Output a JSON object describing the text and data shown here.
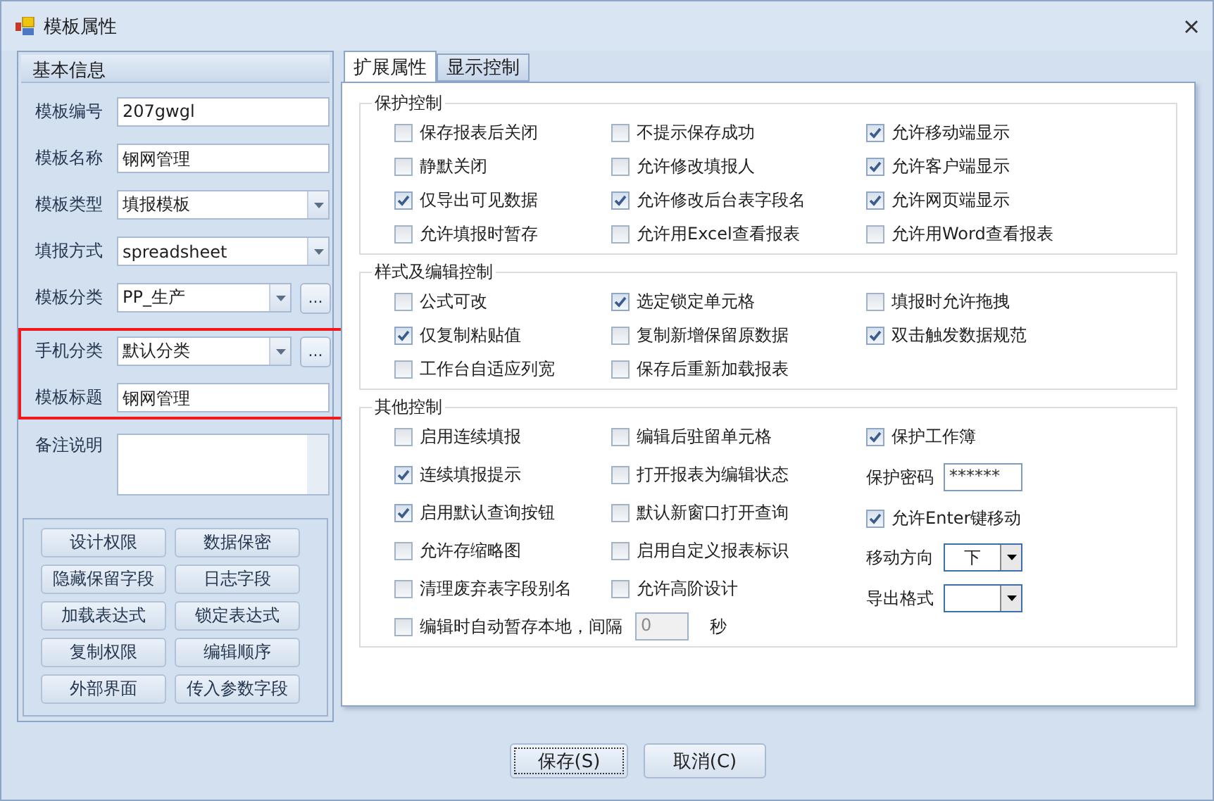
{
  "window": {
    "title": "模板属性"
  },
  "basic_info": {
    "title": "基本信息",
    "fields": [
      {
        "label": "模板编号",
        "kind": "text",
        "value": "207gwgl"
      },
      {
        "label": "模板名称",
        "kind": "text",
        "value": "钢网管理"
      },
      {
        "label": "模板类型",
        "kind": "combo",
        "value": "填报模板"
      },
      {
        "label": "填报方式",
        "kind": "combo",
        "value": "spreadsheet"
      },
      {
        "label": "模板分类",
        "kind": "combo_more",
        "value": "PP_生产",
        "more": "..."
      }
    ],
    "highlighted_fields": [
      {
        "label": "手机分类",
        "kind": "combo_more",
        "value": "默认分类",
        "more": "..."
      },
      {
        "label": "模板标题",
        "kind": "text",
        "value": "钢网管理"
      }
    ],
    "remarks": {
      "label": "备注说明"
    },
    "buttons": [
      "设计权限",
      "数据保密",
      "隐藏保留字段",
      "日志字段",
      "加载表达式",
      "锁定表达式",
      "复制权限",
      "编辑顺序",
      "外部界面",
      "传入参数字段"
    ]
  },
  "tabs": [
    {
      "label": "扩展属性",
      "selected": true
    },
    {
      "label": "显示控制",
      "selected": false
    }
  ],
  "sections": [
    {
      "title": "保护控制",
      "columns": [
        [
          {
            "kind": "checkbox",
            "label": "保存报表后关闭",
            "checked": false
          },
          {
            "kind": "checkbox",
            "label": "静默关闭",
            "checked": false
          },
          {
            "kind": "checkbox",
            "label": "仅导出可见数据",
            "checked": true
          },
          {
            "kind": "checkbox",
            "label": "允许填报时暂存",
            "checked": false
          }
        ],
        [
          {
            "kind": "checkbox",
            "label": "不提示保存成功",
            "checked": false
          },
          {
            "kind": "checkbox",
            "label": "允许修改填报人",
            "checked": false
          },
          {
            "kind": "checkbox",
            "label": "允许修改后台表字段名",
            "checked": true
          },
          {
            "kind": "checkbox",
            "label": "允许用Excel查看报表",
            "checked": false
          }
        ],
        [
          {
            "kind": "checkbox",
            "label": "允许移动端显示",
            "checked": true
          },
          {
            "kind": "checkbox",
            "label": "允许客户端显示",
            "checked": true
          },
          {
            "kind": "checkbox",
            "label": "允许网页端显示",
            "checked": true
          },
          {
            "kind": "checkbox",
            "label": "允许用Word查看报表",
            "checked": false
          }
        ]
      ]
    },
    {
      "title": "样式及编辑控制",
      "columns": [
        [
          {
            "kind": "checkbox",
            "label": "公式可改",
            "checked": false
          },
          {
            "kind": "checkbox",
            "label": "仅复制粘贴值",
            "checked": true
          },
          {
            "kind": "checkbox",
            "label": "工作台自适应列宽",
            "checked": false
          }
        ],
        [
          {
            "kind": "checkbox",
            "label": "选定锁定单元格",
            "checked": true
          },
          {
            "kind": "checkbox",
            "label": "复制新增保留原数据",
            "checked": false
          },
          {
            "kind": "checkbox",
            "label": "保存后重新加载报表",
            "checked": false
          }
        ],
        [
          {
            "kind": "checkbox",
            "label": "填报时允许拖拽",
            "checked": false
          },
          {
            "kind": "checkbox",
            "label": "双击触发数据规范",
            "checked": true
          }
        ]
      ]
    },
    {
      "title": "其他控制",
      "columns": [
        [
          {
            "kind": "checkbox",
            "label": "启用连续填报",
            "checked": false
          },
          {
            "kind": "checkbox",
            "label": "连续填报提示",
            "checked": true
          },
          {
            "kind": "checkbox",
            "label": "启用默认查询按钮",
            "checked": true
          },
          {
            "kind": "checkbox",
            "label": "允许存缩略图",
            "checked": false
          },
          {
            "kind": "checkbox",
            "label": "清理废弃表字段别名",
            "checked": false
          },
          {
            "kind": "interval",
            "label": "编辑时自动暂存本地，间隔",
            "checked": false,
            "value": "0",
            "unit": "秒",
            "disabled": true
          }
        ],
        [
          {
            "kind": "checkbox",
            "label": "编辑后驻留单元格",
            "checked": false
          },
          {
            "kind": "checkbox",
            "label": "打开报表为编辑状态",
            "checked": false
          },
          {
            "kind": "checkbox",
            "label": "默认新窗口打开查询",
            "checked": false
          },
          {
            "kind": "checkbox",
            "label": "启用自定义报表标识",
            "checked": false
          },
          {
            "kind": "checkbox",
            "label": "允许高阶设计",
            "checked": false
          }
        ],
        [
          {
            "kind": "checkbox",
            "label": "保护工作簿",
            "checked": true
          },
          {
            "kind": "password",
            "label": "保护密码",
            "value": "******"
          },
          {
            "kind": "checkbox",
            "label": "允许Enter键移动",
            "checked": true
          },
          {
            "kind": "select",
            "label": "移动方向",
            "value": "下"
          },
          {
            "kind": "select",
            "label": "导出格式"
          }
        ]
      ]
    }
  ],
  "footer_buttons": [
    "保存(S)",
    "取消(C)"
  ]
}
